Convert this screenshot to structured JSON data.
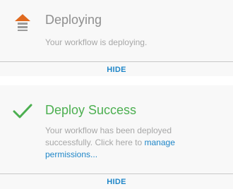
{
  "colors": {
    "accent": "#1f86c8",
    "success": "#4caf50",
    "deploying_icon_top": "#e06a1f",
    "deploying_icon_bars": "#9b9b9b",
    "title_muted": "#8f8f8f",
    "desc_muted": "#a7a7a7"
  },
  "deploying": {
    "icon": "deploy-upload-icon",
    "title": "Deploying",
    "description": "Your workflow is deploying.",
    "hide_label": "HIDE"
  },
  "success": {
    "icon": "checkmark-icon",
    "title": "Deploy Success",
    "description_prefix": "Your workflow has been deployed successfully. Click here to ",
    "link_text": "manage permissions...",
    "hide_label": "HIDE"
  }
}
